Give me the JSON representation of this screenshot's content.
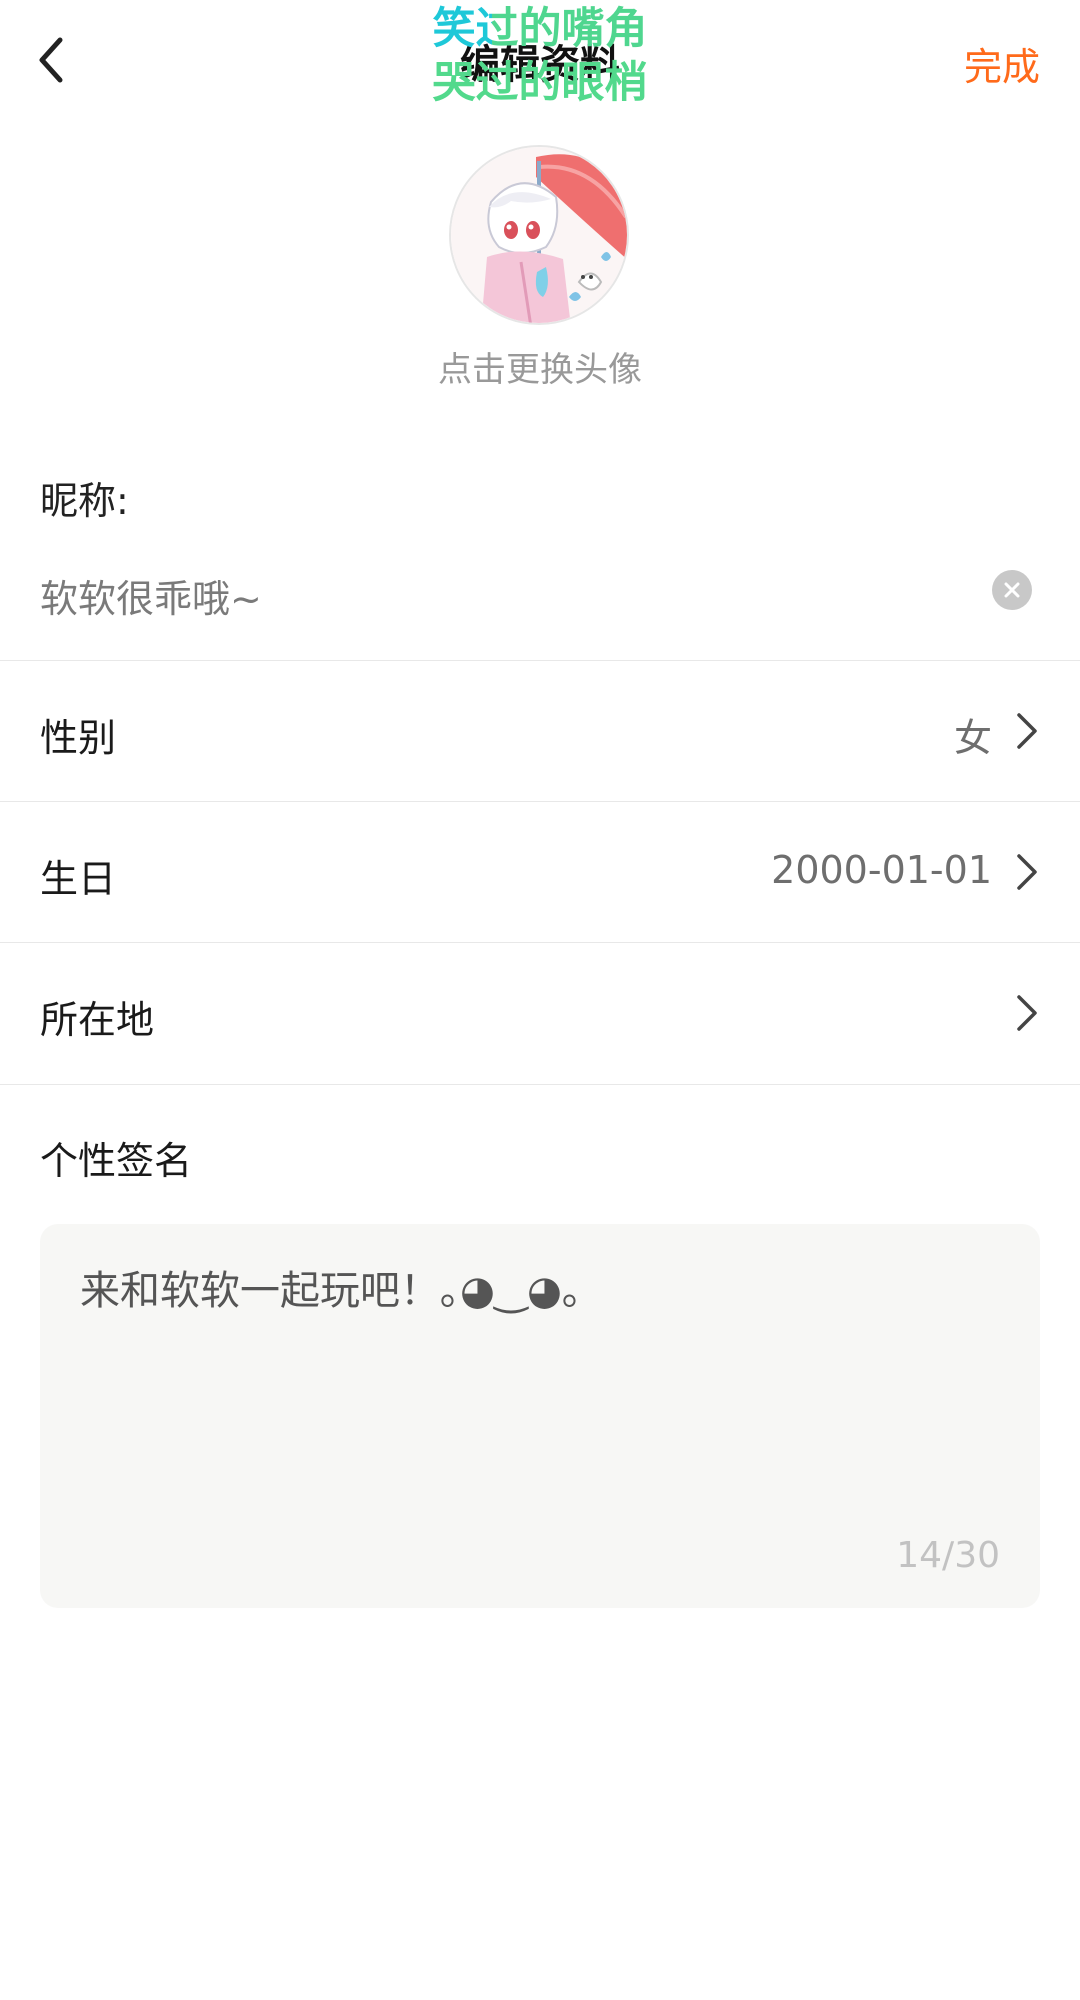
{
  "header": {
    "title": "编辑资料",
    "done_label": "完成"
  },
  "overlay": {
    "line1": "笑过的嘴角",
    "line2": "哭过的眼梢"
  },
  "avatar": {
    "caption": "点击更换头像"
  },
  "nickname": {
    "label": "昵称:",
    "value": "软软很乖哦~"
  },
  "rows": [
    {
      "label": "性别",
      "value": "女"
    },
    {
      "label": "生日",
      "value": "2000-01-01"
    },
    {
      "label": "所在地",
      "value": ""
    }
  ],
  "signature": {
    "label": "个性签名",
    "text": "来和软软一起玩吧！｡◕‿◕｡",
    "count": "14/30"
  },
  "colors": {
    "accent": "#ff6a1a",
    "lyric_cyan": "#1ec8d8",
    "lyric_green": "#4fd68f"
  },
  "icons": {
    "back": "chevron-left-icon",
    "clear": "clear-x-icon",
    "row_arrow": "chevron-right-icon"
  }
}
